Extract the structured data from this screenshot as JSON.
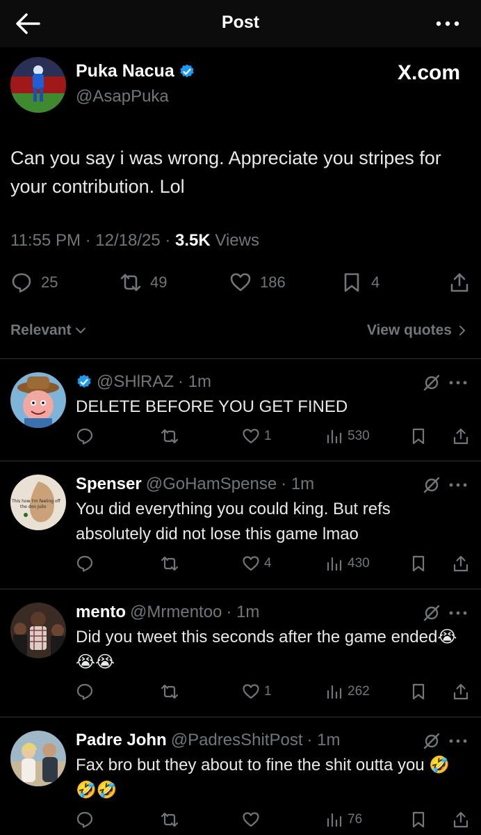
{
  "header": {
    "title": "Post"
  },
  "post": {
    "author_name": "Puka Nacua",
    "author_handle": "@AsapPuka",
    "brand": "X.com",
    "text": "Can you say i was wrong. Appreciate you stripes for your contribution. Lol",
    "time": "11:55 PM · 12/18/25 · ",
    "views_count": "3.5K",
    "views_label": " Views",
    "replies": "25",
    "reposts": "49",
    "likes": "186",
    "bookmarks": "4"
  },
  "sort_label": "Relevant",
  "view_quotes_label": "View quotes",
  "replies": [
    {
      "name": "",
      "handle": "@SHlRAZ",
      "time": "· 1m",
      "verified": true,
      "text": "DELETE BEFORE YOU GET FINED",
      "likes": "1",
      "views": "530",
      "avatar_text": ""
    },
    {
      "name": "Spenser",
      "handle": "@GoHamSpense",
      "time": "· 1m",
      "verified": false,
      "text": "You did everything you could king. But refs absolutely did not lose this game lmao",
      "likes": "4",
      "views": "430",
      "avatar_text": "This how I'm feeling off the don Julio"
    },
    {
      "name": "mento",
      "handle": "@Mrmentoo",
      "time": "· 1m",
      "verified": false,
      "text": "Did you tweet this seconds after the game ended😭😭😭",
      "likes": "1",
      "views": "262",
      "avatar_text": ""
    },
    {
      "name": "Padre John",
      "handle": "@PadresShitPost",
      "time": "· 1m",
      "verified": false,
      "text": "Fax bro but they about to fine the shit outta you 🤣🤣🤣",
      "likes": "",
      "views": "76",
      "avatar_text": ""
    }
  ],
  "colors": {
    "accent": "#1d9bf0",
    "muted": "#71767b",
    "text": "#e7e9ea",
    "bg": "#000000"
  }
}
